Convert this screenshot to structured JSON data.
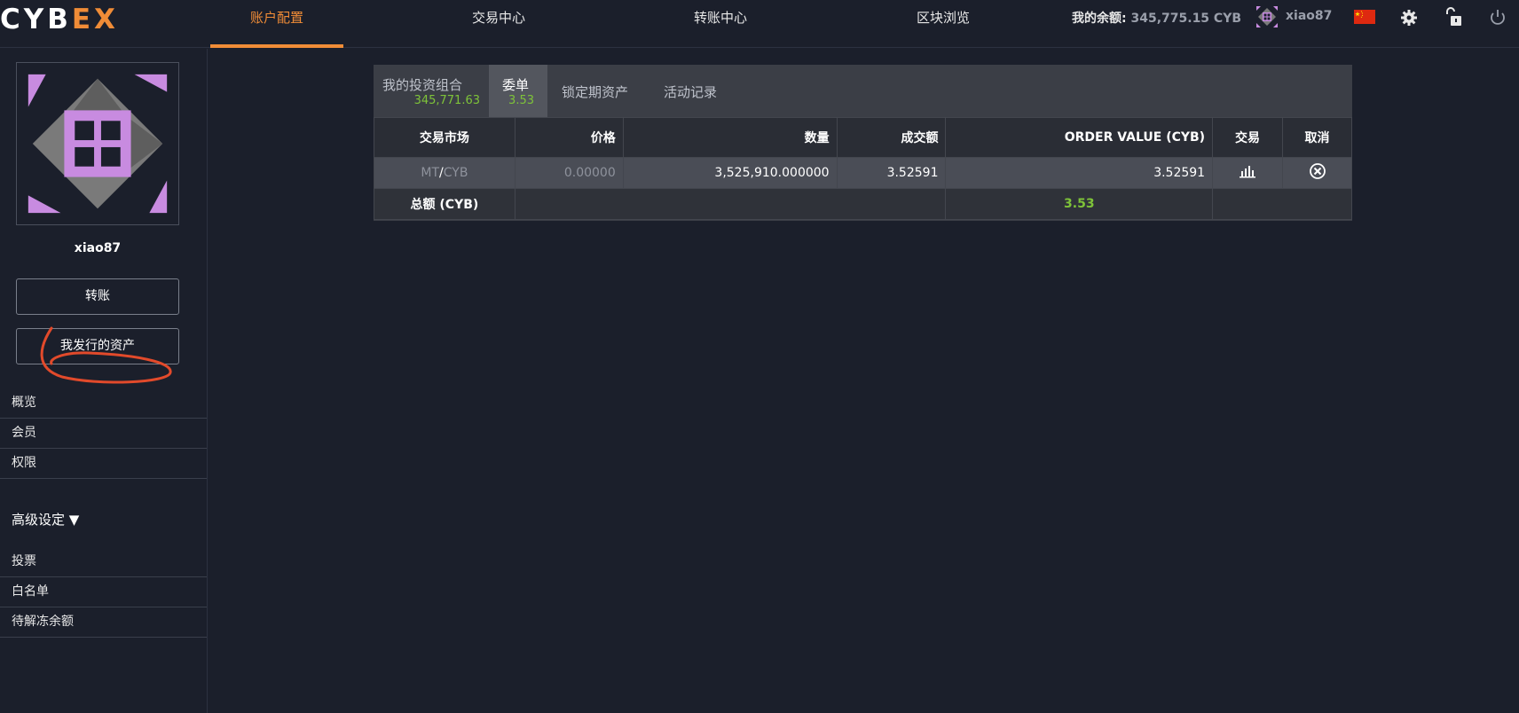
{
  "header": {
    "logo_main": "CYB",
    "logo_accent": "EX",
    "nav": [
      "账户配置",
      "交易中心",
      "转账中心",
      "区块浏览"
    ],
    "balance_label": "我的余额:",
    "balance_value": "345,775.15 CYB",
    "username": "xiao87",
    "flag": "china-flag",
    "icons": [
      "gear-icon",
      "unlock-icon",
      "power-icon"
    ],
    "accent_color": "#f08c37"
  },
  "sidebar": {
    "username": "xiao87",
    "buttons": [
      "转账",
      "我发行的资产"
    ],
    "group1": [
      "概览",
      "会员",
      "权限"
    ],
    "advanced_label": "高级设定 ▼",
    "group2": [
      "投票",
      "白名单",
      "待解冻余额"
    ]
  },
  "panel": {
    "tabs": [
      {
        "label": "我的投资组合",
        "value": "345,771.63"
      },
      {
        "label": "委单",
        "value": "3.53"
      },
      {
        "label": "锁定期资产"
      },
      {
        "label": "活动记录"
      }
    ],
    "columns": [
      "交易市场",
      "价格",
      "数量",
      "成交额",
      "ORDER VALUE (CYB)",
      "交易",
      "取消"
    ],
    "row": {
      "market_base": "MT",
      "market_quote": "CYB",
      "price": "0.00000",
      "amount": "3,525,910.000000",
      "filled": "3.52591",
      "order_value": "3.52591"
    },
    "total_label": "总额 (CYB)",
    "total_value": "3.53",
    "value_color": "#7ec339"
  }
}
